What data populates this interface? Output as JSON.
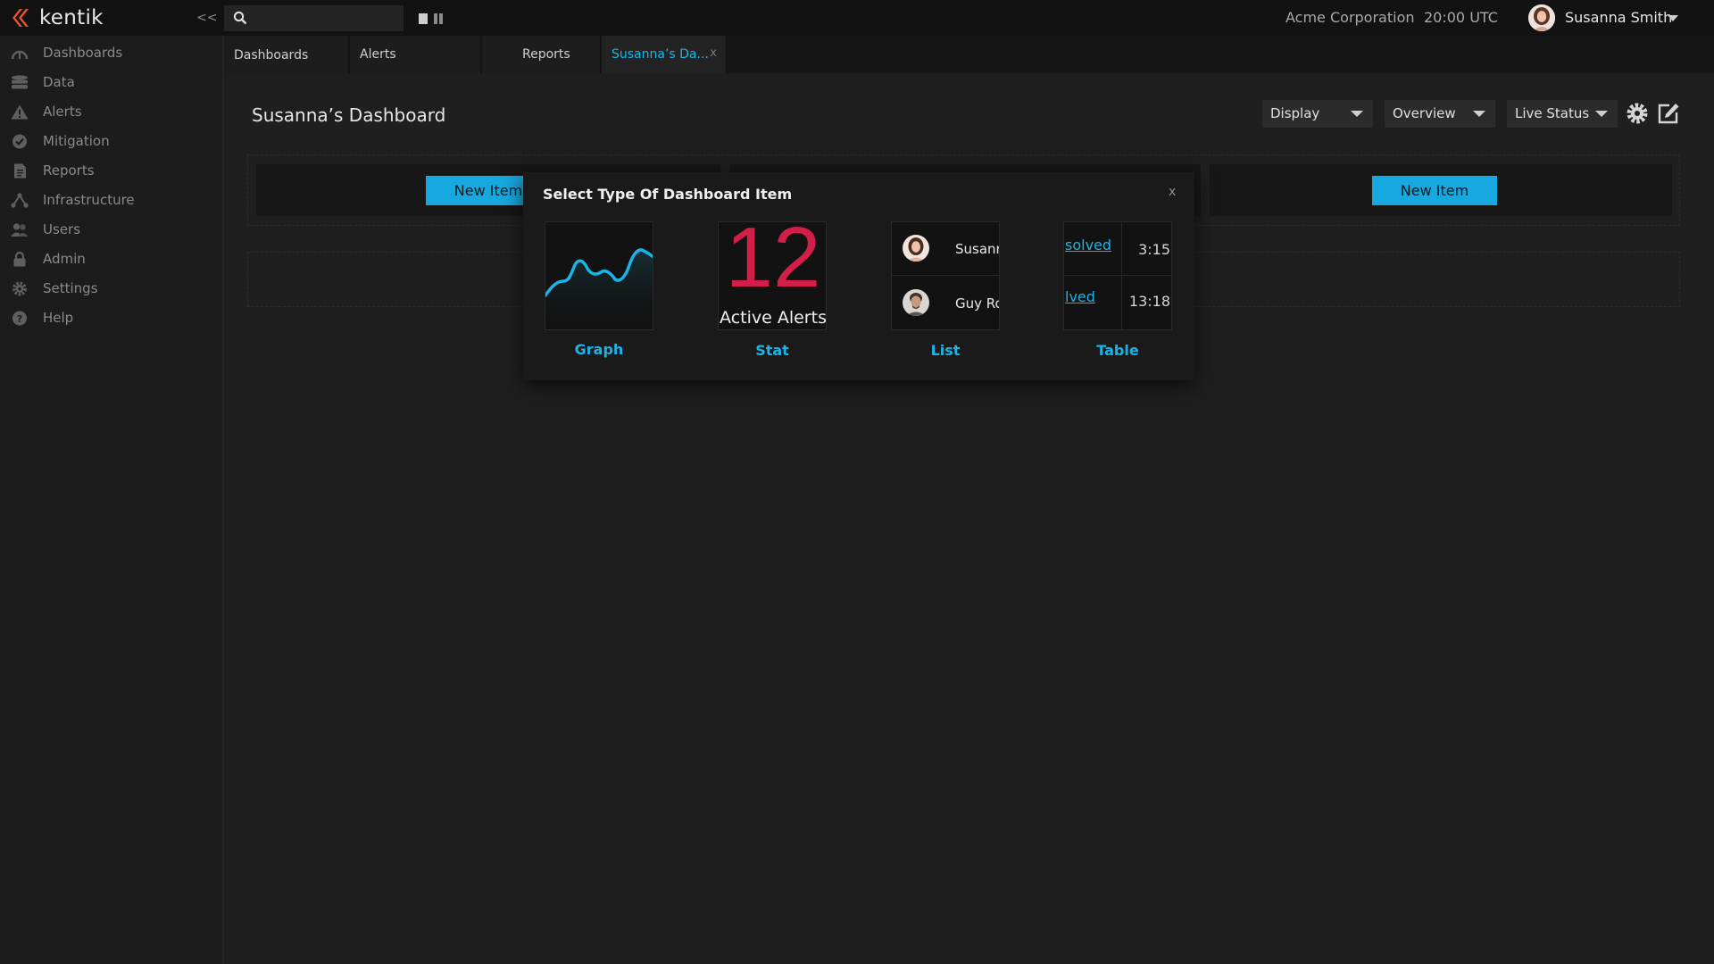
{
  "app": {
    "brand": "kentik",
    "collapse_label": "<<",
    "org_name": "Acme Corporation",
    "clock": "20:00 UTC",
    "user_name": "Susanna Smith",
    "accent_color": "#1ab4e8",
    "brand_color": "#e8542d"
  },
  "sidebar": {
    "items": [
      {
        "label": "Dashboards",
        "icon": "dashboard-gauge-icon"
      },
      {
        "label": "Data",
        "icon": "database-icon"
      },
      {
        "label": "Alerts",
        "icon": "warning-triangle-icon"
      },
      {
        "label": "Mitigation",
        "icon": "check-circle-icon"
      },
      {
        "label": "Reports",
        "icon": "document-icon"
      },
      {
        "label": "Infrastructure",
        "icon": "network-nodes-icon"
      },
      {
        "label": "Users",
        "icon": "users-icon"
      },
      {
        "label": "Admin",
        "icon": "lock-icon"
      },
      {
        "label": "Settings",
        "icon": "gear-icon"
      },
      {
        "label": "Help",
        "icon": "question-circle-icon"
      }
    ]
  },
  "tabs": [
    {
      "label": "Dashboards"
    },
    {
      "label": "Alerts"
    },
    {
      "label": "Reports"
    },
    {
      "label": "Susanna’s Da...",
      "close": "x",
      "active": true
    }
  ],
  "header": {
    "title": "Susanna’s Dashboard",
    "dropdowns": {
      "display": "Display",
      "overview": "Overview",
      "live_status": "Live Status"
    }
  },
  "dashboard": {
    "new_item_label": "New Item"
  },
  "modal": {
    "title": "Select Type Of Dashboard Item",
    "close": "x",
    "options": {
      "graph": "Graph",
      "stat": "Stat",
      "list": "List",
      "table": "Table"
    },
    "stat_preview": {
      "value": "12",
      "caption": "Active Alerts",
      "value_color": "#d31f47"
    },
    "list_preview": [
      "Susann",
      "Guy Ro"
    ],
    "table_preview": [
      {
        "status": "solved",
        "time": "3:15"
      },
      {
        "status": "lved",
        "time": "13:18"
      }
    ]
  }
}
